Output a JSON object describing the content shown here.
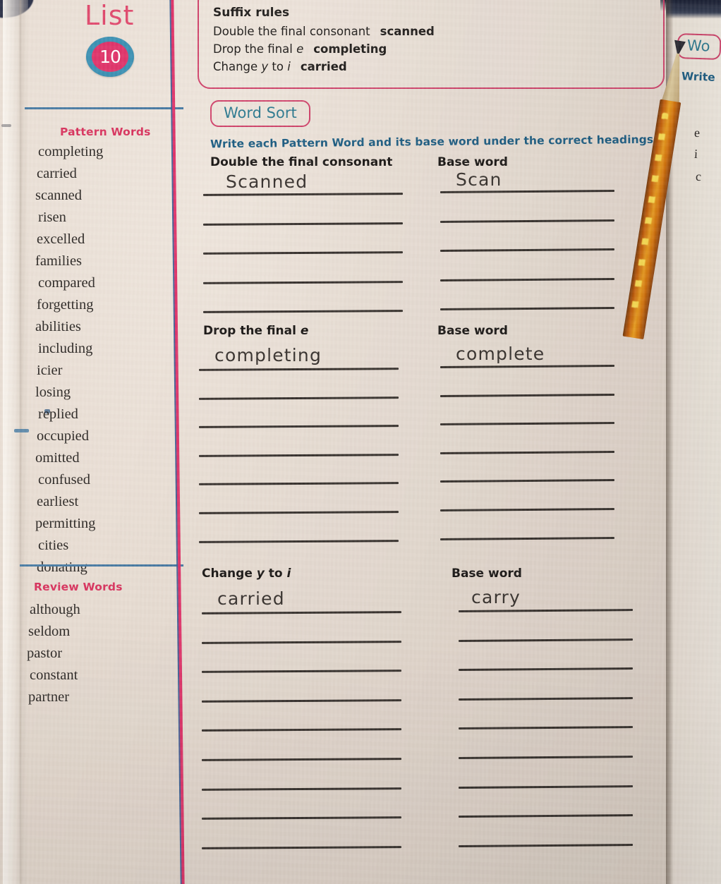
{
  "workbook": {
    "list_title": "List",
    "list_number": "10"
  },
  "suffix_rules": {
    "title": "Suffix rules",
    "rules": [
      {
        "text_before": "Double the final consonant",
        "italic": "",
        "text_after": "",
        "example": "scanned"
      },
      {
        "text_before": "Drop the final ",
        "italic": "e",
        "text_after": "",
        "example": "completing"
      },
      {
        "text_before": "Change ",
        "italic": "y",
        "text_mid": " to ",
        "italic2": "i",
        "text_after": "",
        "example": "carried"
      }
    ]
  },
  "word_sort": {
    "chip_label": "Word Sort",
    "instruction": "Write each Pattern Word and its base word under the correct headings.",
    "sections": [
      {
        "heading_before": "Double the final consonant",
        "heading_italic": "",
        "heading_after": "",
        "base_heading": "Base word",
        "line_count": 5,
        "answer_left": "Scanned",
        "answer_right": "Scan"
      },
      {
        "heading_before": "Drop the final ",
        "heading_italic": "e",
        "heading_after": "",
        "base_heading": "Base word",
        "line_count": 7,
        "answer_left": "completing",
        "answer_right": "complete"
      },
      {
        "heading_before": "Change ",
        "heading_italic": "y",
        "heading_mid": " to ",
        "heading_italic2": "i",
        "heading_after": "",
        "base_heading": "Base word",
        "line_count": 9,
        "answer_left": "carried",
        "answer_right": "carry"
      }
    ]
  },
  "pattern_words": {
    "heading": "Pattern Words",
    "words": [
      "completing",
      "carried",
      "scanned",
      "risen",
      "excelled",
      "families",
      "compared",
      "forgetting",
      "abilities",
      "including",
      "icier",
      "losing",
      "replied",
      "occupied",
      "omitted",
      "confused",
      "earliest",
      "permitting",
      "cities",
      "donating"
    ]
  },
  "review_words": {
    "heading": "Review Words",
    "words": [
      "although",
      "seldom",
      "pastor",
      "constant",
      "partner"
    ]
  },
  "facing_page": {
    "chip_partial": "Wo",
    "instruction_partial": "Write",
    "list_fragments": [
      "e",
      "i",
      "c"
    ]
  },
  "colors": {
    "accent_pink": "#e0366b",
    "accent_blue": "#3e92b4",
    "heading_blue": "#1f5f84",
    "paper": "#e8ddd3",
    "ink": "#3a3430"
  }
}
